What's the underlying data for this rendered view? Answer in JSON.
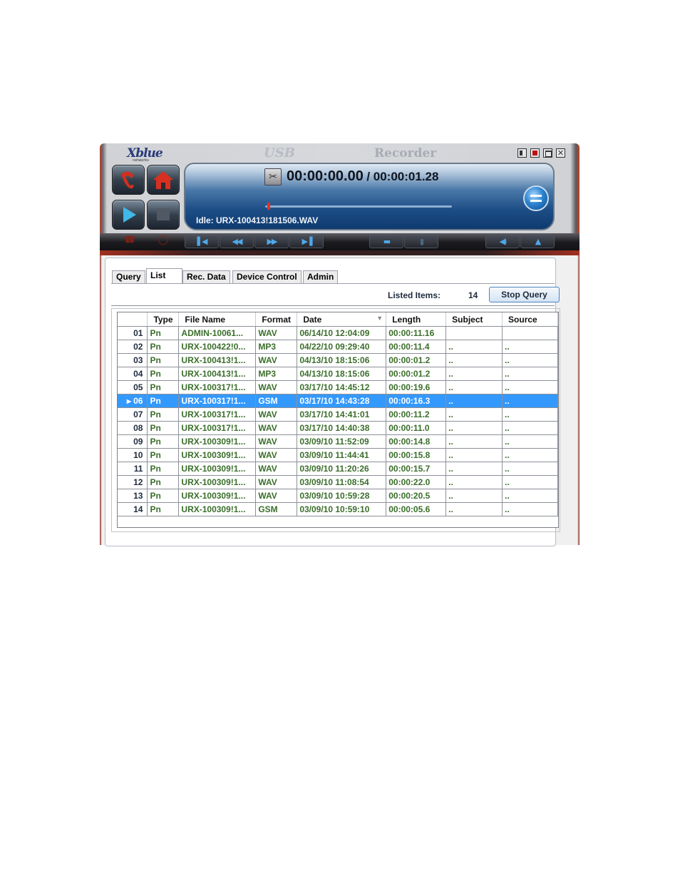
{
  "window": {
    "logo": "Xblue",
    "logo_sub": "networks",
    "title_prefix": "USB",
    "title": "Recorder"
  },
  "player": {
    "current_time": "00:00:00.00",
    "total_time": "/ 00:00:01.28",
    "progress": 0.01,
    "status": "Idle: URX-100413!181506.WAV"
  },
  "tabs": [
    {
      "label": "Query",
      "active": false
    },
    {
      "label": "List",
      "active": true
    },
    {
      "label": "Rec. Data",
      "active": false
    },
    {
      "label": "Device Control",
      "active": false
    },
    {
      "label": "Admin",
      "active": false
    }
  ],
  "list_info": {
    "listed_label": "Listed Items:",
    "listed_count": "14",
    "stop_button": "Stop Query"
  },
  "columns": [
    "Type",
    "File Name",
    "Format",
    "Date",
    "Length",
    "Subject",
    "Source"
  ],
  "selected_row": "06",
  "rows": [
    {
      "num": "01",
      "type": "Pn",
      "file": "ADMIN-10061...",
      "format": "WAV",
      "date": "06/14/10 12:04:09",
      "length": "00:00:11.16",
      "subject": "",
      "source": ""
    },
    {
      "num": "02",
      "type": "Pn",
      "file": "URX-100422!0...",
      "format": "MP3",
      "date": "04/22/10 09:29:40",
      "length": "00:00:11.4",
      "subject": "..",
      "source": ".."
    },
    {
      "num": "03",
      "type": "Pn",
      "file": "URX-100413!1...",
      "format": "WAV",
      "date": "04/13/10 18:15:06",
      "length": "00:00:01.2",
      "subject": "..",
      "source": ".."
    },
    {
      "num": "04",
      "type": "Pn",
      "file": "URX-100413!1...",
      "format": "MP3",
      "date": "04/13/10 18:15:06",
      "length": "00:00:01.2",
      "subject": "..",
      "source": ".."
    },
    {
      "num": "05",
      "type": "Pn",
      "file": "URX-100317!1...",
      "format": "WAV",
      "date": "03/17/10 14:45:12",
      "length": "00:00:19.6",
      "subject": "..",
      "source": ".."
    },
    {
      "num": "06",
      "type": "Pn",
      "file": "URX-100317!1...",
      "format": "GSM",
      "date": "03/17/10 14:43:28",
      "length": "00:00:16.3",
      "subject": "..",
      "source": ".."
    },
    {
      "num": "07",
      "type": "Pn",
      "file": "URX-100317!1...",
      "format": "WAV",
      "date": "03/17/10 14:41:01",
      "length": "00:00:11.2",
      "subject": "..",
      "source": ".."
    },
    {
      "num": "08",
      "type": "Pn",
      "file": "URX-100317!1...",
      "format": "WAV",
      "date": "03/17/10 14:40:38",
      "length": "00:00:11.0",
      "subject": "..",
      "source": ".."
    },
    {
      "num": "09",
      "type": "Pn",
      "file": "URX-100309!1...",
      "format": "WAV",
      "date": "03/09/10 11:52:09",
      "length": "00:00:14.8",
      "subject": "..",
      "source": ".."
    },
    {
      "num": "10",
      "type": "Pn",
      "file": "URX-100309!1...",
      "format": "WAV",
      "date": "03/09/10 11:44:41",
      "length": "00:00:15.8",
      "subject": "..",
      "source": ".."
    },
    {
      "num": "11",
      "type": "Pn",
      "file": "URX-100309!1...",
      "format": "WAV",
      "date": "03/09/10 11:20:26",
      "length": "00:00:15.7",
      "subject": "..",
      "source": ".."
    },
    {
      "num": "12",
      "type": "Pn",
      "file": "URX-100309!1...",
      "format": "WAV",
      "date": "03/09/10 11:08:54",
      "length": "00:00:22.0",
      "subject": "..",
      "source": ".."
    },
    {
      "num": "13",
      "type": "Pn",
      "file": "URX-100309!1...",
      "format": "WAV",
      "date": "03/09/10 10:59:28",
      "length": "00:00:20.5",
      "subject": "..",
      "source": ".."
    },
    {
      "num": "14",
      "type": "Pn",
      "file": "URX-100309!1...",
      "format": "GSM",
      "date": "03/09/10 10:59:10",
      "length": "00:00:05.6",
      "subject": "..",
      "source": ".."
    }
  ],
  "colors": {
    "selection": "#3399ff",
    "cell_text": "#3a6e2a"
  }
}
